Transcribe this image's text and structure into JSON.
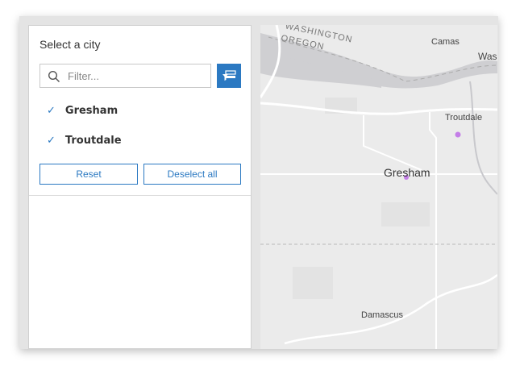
{
  "panel": {
    "title": "Select a city",
    "filter_placeholder": "Filter...",
    "items": [
      {
        "label": "Gresham",
        "checked": true
      },
      {
        "label": "Troutdale",
        "checked": true
      }
    ],
    "reset_label": "Reset",
    "deselect_label": "Deselect all"
  },
  "map": {
    "labels": {
      "washington": "WASHINGTON",
      "oregon": "OREGON",
      "camas": "Camas",
      "was": "Was",
      "troutdale": "Troutdale",
      "gresham": "Gresham",
      "damascus": "Damascus"
    },
    "point_color": "#c47ee8"
  }
}
